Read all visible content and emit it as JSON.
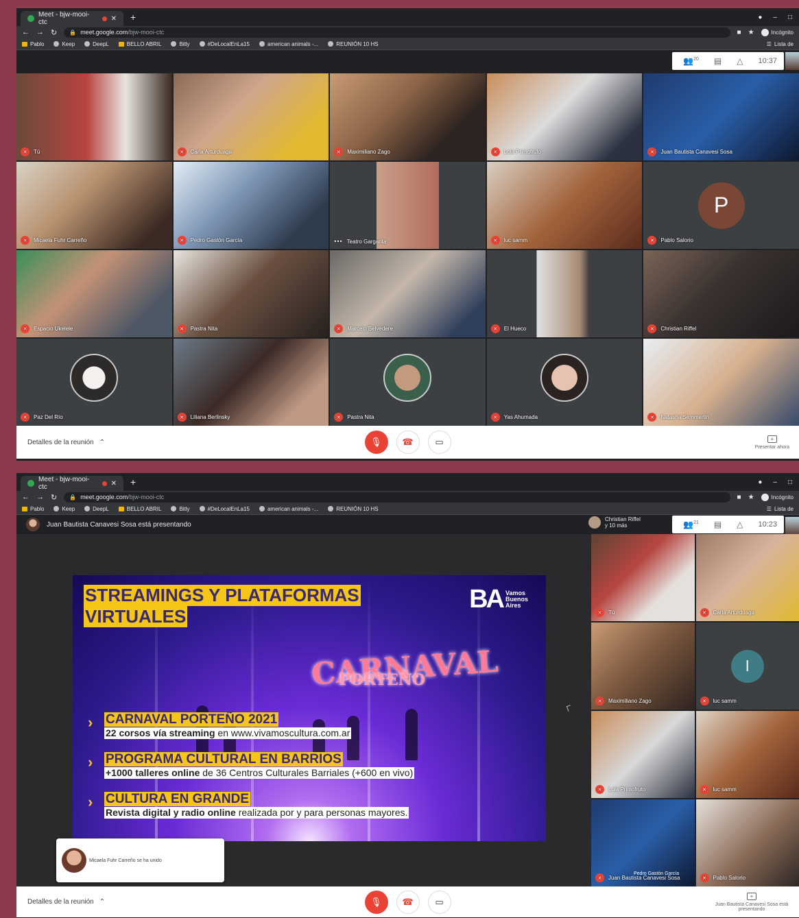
{
  "browser": {
    "tab_title": "Meet - bjw-mooi-ctc",
    "url_host": "meet.google.com",
    "url_path": "/bjw-mooi-ctc",
    "incognito": "Incógnito",
    "bookmarks": [
      "Pablo",
      "Keep",
      "DeepL",
      "BELLO ABRIL",
      "Bitly",
      "#DeLocalEnLa15",
      "american animals -...",
      "REUNIÓN 10 HS"
    ],
    "reading_list": "Lista de"
  },
  "meeting1": {
    "time": "10:37",
    "participants_count": "20",
    "tiles": [
      {
        "name": "Tú",
        "bg": "linear-gradient(90deg,#6b4a3c,#b9433f 45%,#e9e4df 70%,#3a2a22)",
        "type": "video"
      },
      {
        "name": "Carla Arturduaga",
        "bg": "linear-gradient(135deg,#8a6a56,#cfa58c 40%,#e0b92f 80%)",
        "type": "video"
      },
      {
        "name": "Maximiliano Zago",
        "bg": "linear-gradient(135deg,#c99c74,#8d6447 40%,#2d2320 75%)",
        "type": "video"
      },
      {
        "name": "Lola Primofruto",
        "bg": "linear-gradient(135deg,#c98d5a,#dcdcdc 45%,#2b3140 85%)",
        "type": "video"
      },
      {
        "name": "Juan Bautista Canavesi Sosa",
        "bg": "linear-gradient(135deg,#1e3b6e,#2a5ea8 50%,#0d1830)",
        "type": "video"
      },
      {
        "name": "Micaela Fuhr Carreño",
        "bg": "linear-gradient(135deg,#d8d2c5,#b8916e 40%,#3b2a24 85%)",
        "type": "video"
      },
      {
        "name": "Pedro Gastón García",
        "bg": "linear-gradient(135deg,#e3eef6,#7e96b5 40%,#2f3c4e 80%)",
        "type": "video"
      },
      {
        "name": "Teatro Garganta",
        "bg": "linear-gradient(90deg,#3c4043 30%,#c9a08a 30%,#b26c5b 70%,#3c4043 70%)",
        "type": "video",
        "dots": true
      },
      {
        "name": "luc samm",
        "bg": "linear-gradient(135deg,#d9cfc2,#a3643c 50%,#5a2c1c)",
        "type": "video"
      },
      {
        "name": "Pablo Salorio",
        "bg": "#3c4043",
        "type": "letter",
        "letter": "P"
      },
      {
        "name": "Espacio Ukelele",
        "bg": "linear-gradient(135deg,#3a8f5a,#c49276 40%,#4d5766 80%)",
        "type": "video"
      },
      {
        "name": "Pastra Nita",
        "bg": "linear-gradient(135deg,#e9e6df,#6b5142 45%,#26201d)",
        "type": "video"
      },
      {
        "name": "Marcelo Belvedere",
        "bg": "linear-gradient(135deg,#6a6865,#c4b7aa 45%,#30405c 85%)",
        "type": "video"
      },
      {
        "name": "El Hueco",
        "bg": "linear-gradient(90deg,#3c4043 32%,#e2e2e2 32%,#a98a72 60%,#3c4043 66%)",
        "type": "video"
      },
      {
        "name": "Christian Riffel",
        "bg": "linear-gradient(135deg,#7a6456,#3a3230 45%,#1c1a19)",
        "type": "video"
      },
      {
        "name": "Paz Del Río",
        "bg": "#3c4043",
        "type": "avatar",
        "avatar": "radial-gradient(circle,#f3f0ee 35%,#2d2a2a 36%)"
      },
      {
        "name": "Liliana Berlinsky",
        "bg": "linear-gradient(135deg,#6b7b8a,#3b2a26 45%,#c09884 80%)",
        "type": "video"
      },
      {
        "name": "Pastra Nita",
        "bg": "#3c4043",
        "type": "avatar",
        "avatar": "radial-gradient(circle,#c49a7f 40%,#3a5f4a 41%)"
      },
      {
        "name": "Yas Ahumada",
        "bg": "#3c4043",
        "type": "avatar",
        "avatar": "radial-gradient(circle,#e6c3b0 40%,#2a2322 41%)"
      },
      {
        "name": "Natasha Semmertin",
        "bg": "linear-gradient(135deg,#e9eef3,#d7b08e 50%,#354a6a)",
        "type": "video"
      }
    ],
    "details_label": "Detalles de la reunión",
    "present_label": "Presentar ahora"
  },
  "meeting2": {
    "presenter_banner": "Juan Bautista Canavesi Sosa está presentando",
    "others_name": "Christian Riffel",
    "others_more": "y 10 más",
    "time": "10:23",
    "participants_count": "21",
    "slide": {
      "title_line1": "STREAMINGS Y PLATAFORMAS",
      "title_line2": "VIRTUALES",
      "logo_mark": "BA",
      "logo_line1": "Vamos",
      "logo_line2": "Buenos",
      "logo_line3": "Aires",
      "carnaval": "CARNAVAL",
      "porteno": "PORTEÑO",
      "bullets": [
        {
          "head": "CARNAVAL PORTEÑO 2021",
          "bold": "22 corsos vía streaming",
          "rest": " en www.vivamoscultura.com.ar"
        },
        {
          "head": "PROGRAMA CULTURAL EN BARRIOS",
          "bold": "+1000 talleres online",
          "rest": " de 36 Centros Culturales Barriales (+600 en vivo)"
        },
        {
          "head": "CULTURA EN GRANDE",
          "bold": "Revista digital y radio online",
          "rest": " realizada por y para personas mayores."
        }
      ]
    },
    "side_tiles": [
      {
        "name": "Tú",
        "bg": "linear-gradient(135deg,#5e4235,#b74640 40%,#e4e0dc 70%)",
        "type": "video"
      },
      {
        "name": "Carla Arturduaga",
        "bg": "linear-gradient(135deg,#9d7a66,#d8b39c 45%,#e0b92f)",
        "type": "video"
      },
      {
        "name": "Maximiliano Zago",
        "bg": "linear-gradient(135deg,#c99c74,#7f5a40 45%,#2d2320)",
        "type": "video"
      },
      {
        "name": "luc samm",
        "bg": "#3c4043",
        "type": "letter",
        "letter": "l"
      },
      {
        "name": "Lola Primofruto",
        "bg": "linear-gradient(135deg,#c98d5a,#d8d8d8 50%,#2b3140)",
        "type": "video"
      },
      {
        "name": "luc samm",
        "bg": "linear-gradient(135deg,#ded4c6,#a3643c 50%,#5a2c1c)",
        "type": "video"
      },
      {
        "name": "Juan Bautista Canavesi Sosa",
        "bg": "linear-gradient(135deg,#1e3b6e,#2a5ea8 50%,#0d1830)",
        "type": "video"
      },
      {
        "name": "Pablo Salorio",
        "bg": "linear-gradient(135deg,#e5e0d9,#8a6b58 55%,#2d2724)",
        "type": "video"
      }
    ],
    "toast_text": "Micaela Fuhr Carreño se ha unido",
    "under_toast_name": "Pedro Gastón García",
    "details_label": "Detalles de la reunión",
    "present_label": "Juan Bautista Canavesi Sosa está presentando"
  }
}
